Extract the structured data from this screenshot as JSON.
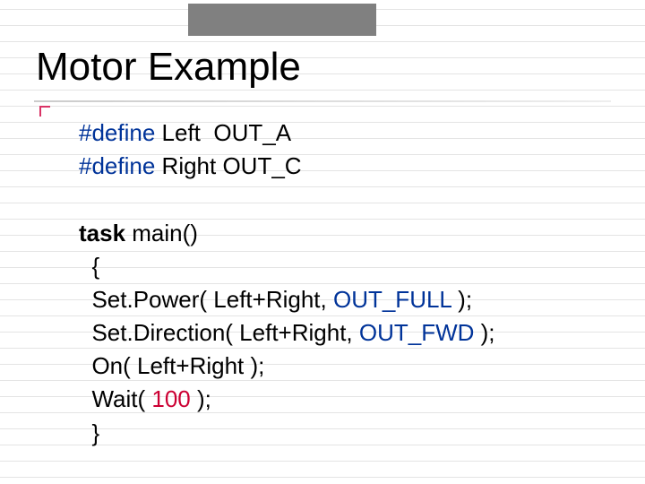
{
  "title": "Motor Example",
  "code": {
    "l1_define": "#define",
    "l1_rest": " Left  OUT_A",
    "l2_define": "#define",
    "l2_rest": " Right OUT_C",
    "l3_task": "task",
    "l3_rest": " main()",
    "l4": "  {",
    "l5a": "  Set.Power( Left+Right, ",
    "l5_const": "OUT_FULL",
    "l5b": " );",
    "l6a": "  Set.Direction( Left+Right, ",
    "l6_const": "OUT_FWD",
    "l6b": " );",
    "l7": "  On( Left+Right );",
    "l8a": "  Wait( ",
    "l8_num": "100",
    "l8b": " );",
    "l9": "  }"
  }
}
